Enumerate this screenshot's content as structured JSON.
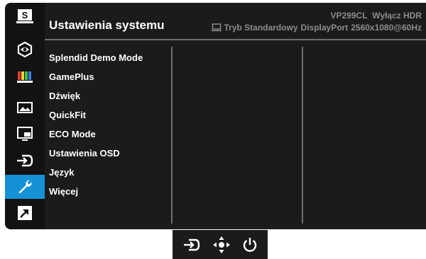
{
  "header": {
    "title": "Ustawienia systemu",
    "model": "VP299CL",
    "hdr_status": "Wyłącz HDR",
    "mode": "Tryb Standardowy",
    "input": "DisplayPort",
    "resolution": "2560x1080@60Hz"
  },
  "sidebar": {
    "items": [
      {
        "icon": "splendid-s-icon"
      },
      {
        "icon": "eye-icon"
      },
      {
        "icon": "color-bars-icon"
      },
      {
        "icon": "image-icon"
      },
      {
        "icon": "pip-icon"
      },
      {
        "icon": "input-select-icon"
      },
      {
        "icon": "wrench-icon",
        "active": true
      },
      {
        "icon": "shortcut-arrow-icon"
      }
    ]
  },
  "menu": {
    "items": [
      "Splendid Demo Mode",
      "GamePlus",
      "Dźwięk",
      "QuickFit",
      "ECO Mode",
      "Ustawienia OSD",
      "Język",
      "Więcej"
    ]
  },
  "keypad": {
    "icons": [
      "input-select-icon",
      "navigation-joystick-icon",
      "power-icon"
    ]
  },
  "colors": {
    "accent": "#1591d6",
    "panel": "#1b1b1b",
    "text": "#ffffff",
    "muted": "#8c8c8c"
  }
}
